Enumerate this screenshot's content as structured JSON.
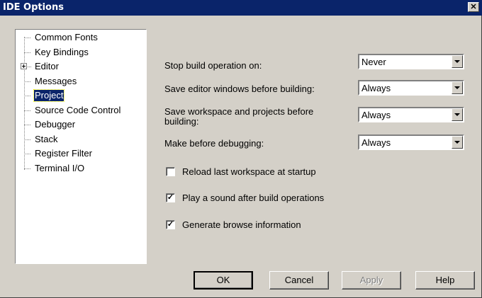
{
  "window": {
    "title": "IDE Options",
    "close_glyph": "✕"
  },
  "tree": {
    "items": [
      {
        "label": "Common Fonts",
        "expandable": false,
        "selected": false
      },
      {
        "label": "Key Bindings",
        "expandable": false,
        "selected": false
      },
      {
        "label": "Editor",
        "expandable": true,
        "selected": false
      },
      {
        "label": "Messages",
        "expandable": false,
        "selected": false
      },
      {
        "label": "Project",
        "expandable": false,
        "selected": true
      },
      {
        "label": "Source Code Control",
        "expandable": false,
        "selected": false
      },
      {
        "label": "Debugger",
        "expandable": false,
        "selected": false
      },
      {
        "label": "Stack",
        "expandable": false,
        "selected": false
      },
      {
        "label": "Register Filter",
        "expandable": false,
        "selected": false
      },
      {
        "label": "Terminal I/O",
        "expandable": false,
        "selected": false
      }
    ]
  },
  "settings": {
    "stop_build": {
      "label": "Stop build operation on:",
      "value": "Never"
    },
    "save_editor": {
      "label": "Save editor windows before building:",
      "value": "Always"
    },
    "save_workspace": {
      "label_line1": "Save workspace and projects before",
      "label_line2": "building:",
      "value": "Always"
    },
    "make_before_debug": {
      "label": "Make before debugging:",
      "value": "Always"
    }
  },
  "checkboxes": {
    "reload_workspace": {
      "label": "Reload last workspace at startup",
      "checked": false
    },
    "play_sound": {
      "label": "Play a sound after build operations",
      "checked": true
    },
    "browse_info": {
      "label": "Generate browse information",
      "checked": true
    }
  },
  "buttons": {
    "ok": "OK",
    "cancel": "Cancel",
    "apply": "Apply",
    "help": "Help"
  },
  "icons": {
    "check": "✓",
    "dropdown": "chevron-down-icon",
    "expand": "plus-box-icon"
  }
}
